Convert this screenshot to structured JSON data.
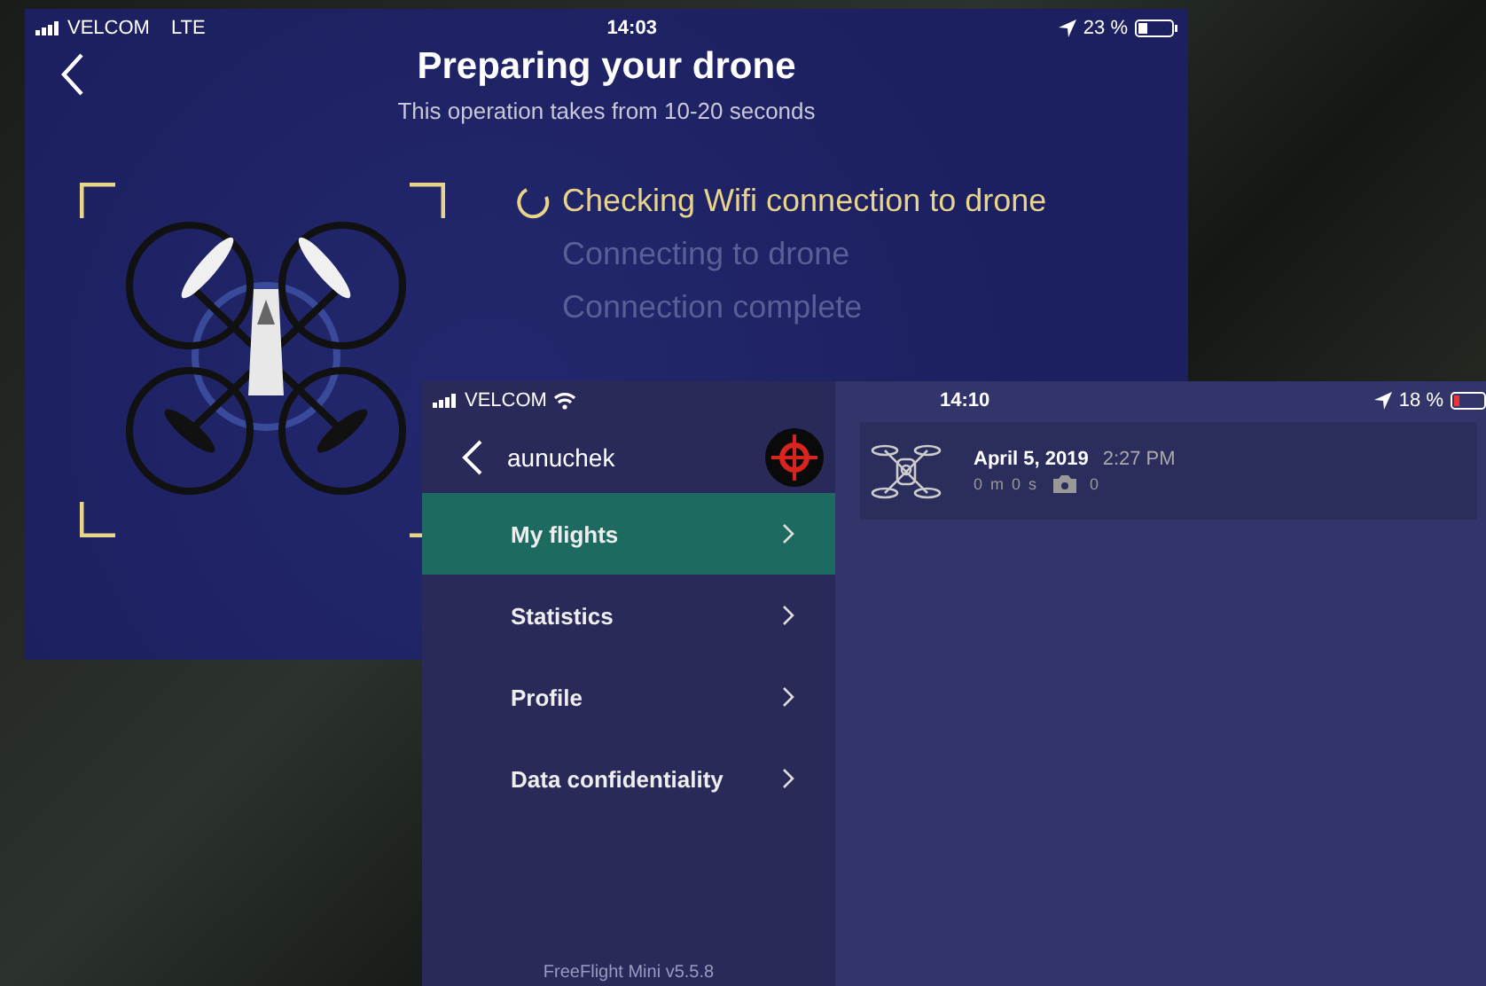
{
  "preparing_screen": {
    "status_bar": {
      "carrier": "VELCOM",
      "network": "LTE",
      "time": "14:03",
      "battery": "23 %"
    },
    "title": "Preparing your drone",
    "subtitle": "This operation takes from 10-20 seconds",
    "steps": [
      {
        "label": "Checking Wifi connection to drone",
        "active": true
      },
      {
        "label": "Connecting to drone",
        "active": false
      },
      {
        "label": "Connection complete",
        "active": false
      }
    ]
  },
  "account_screen": {
    "status_bar": {
      "carrier": "VELCOM",
      "time": "14:10",
      "battery": "18 %"
    },
    "username": "aunuchek",
    "menu": [
      {
        "label": "My flights",
        "selected": true
      },
      {
        "label": "Statistics",
        "selected": false
      },
      {
        "label": "Profile",
        "selected": false
      },
      {
        "label": "Data confidentiality",
        "selected": false
      }
    ],
    "version": "FreeFlight Mini v5.5.8",
    "flights": [
      {
        "date": "April 5, 2019",
        "time": "2:27 PM",
        "duration": "0 m 0 s",
        "photos": "0"
      }
    ]
  }
}
